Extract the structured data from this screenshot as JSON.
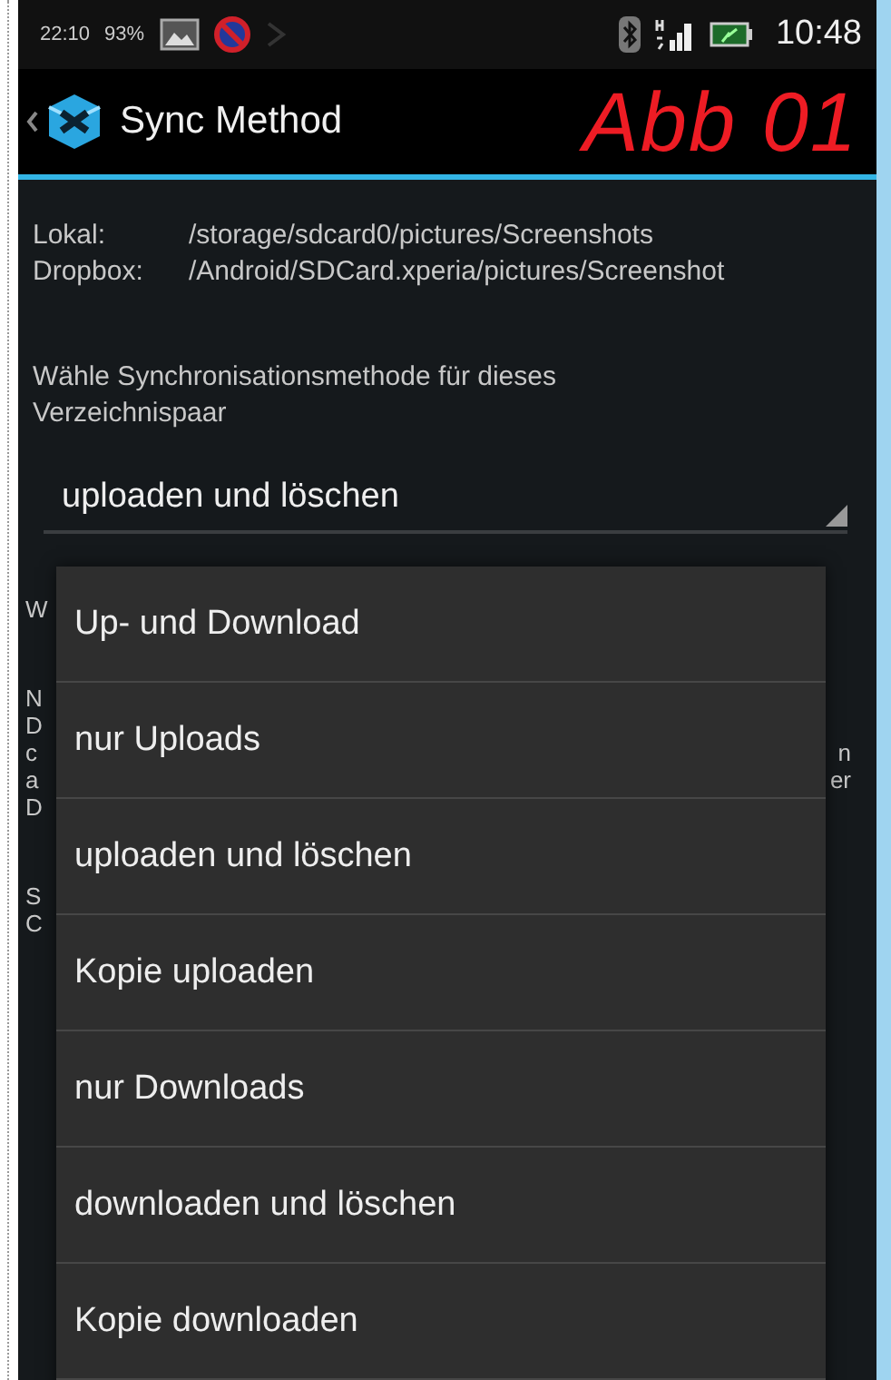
{
  "status_bar": {
    "clock_small": "22:10",
    "battery_percent": "93%",
    "time": "10:48"
  },
  "action_bar": {
    "title": "Sync Method",
    "annotation": "Abb 01"
  },
  "paths": [
    {
      "label": "Lokal:",
      "value": "/storage/sdcard0/pictures/Screenshots"
    },
    {
      "label": "Dropbox:",
      "value": "/Android/SDCard.xperia/pictures/Screenshot"
    }
  ],
  "prompt": "Wähle Synchronisationsmethode für dieses Verzeichnispaar",
  "spinner": {
    "value": "uploaden und löschen"
  },
  "hidden_text_fragments": [
    {
      "lines": [
        {
          "left": "W"
        }
      ]
    },
    {
      "lines": [
        {
          "left": "N"
        },
        {
          "left": "D"
        },
        {
          "left": "c",
          "right": "n"
        },
        {
          "left": "a",
          "right": "er"
        },
        {
          "left": "D"
        }
      ]
    },
    {
      "lines": [
        {
          "left": "S"
        },
        {
          "left": "C"
        }
      ]
    }
  ],
  "menu": {
    "items": [
      {
        "label": "Up- und Download"
      },
      {
        "label": "nur Uploads"
      },
      {
        "label": "uploaden und löschen"
      },
      {
        "label": "Kopie uploaden"
      },
      {
        "label": "nur Downloads"
      },
      {
        "label": "downloaden und löschen"
      },
      {
        "label": "Kopie downloaden"
      }
    ]
  }
}
